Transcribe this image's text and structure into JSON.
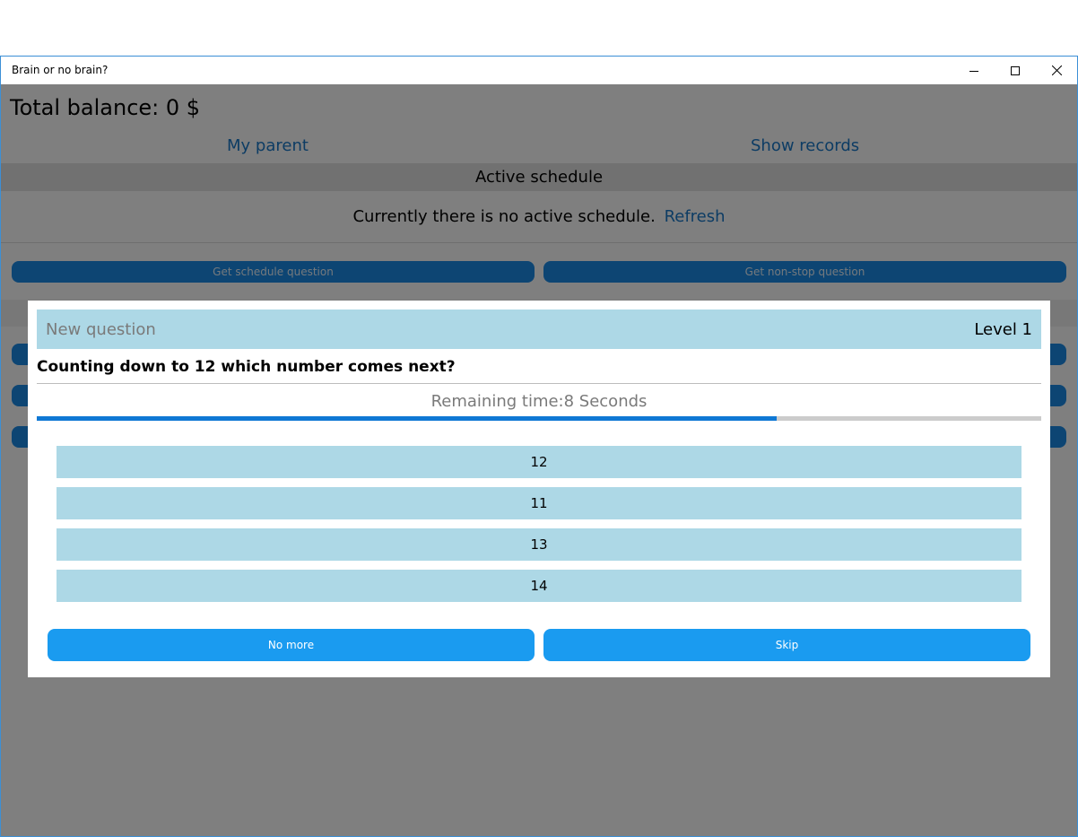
{
  "window": {
    "title": "Brain or no brain?",
    "controls": {
      "minimize": "minimize-icon",
      "maximize": "maximize-icon",
      "close": "close-icon"
    }
  },
  "main": {
    "balance": "Total balance: 0 $",
    "nav": {
      "parent": "My parent",
      "records": "Show records"
    },
    "schedule_header": "Active schedule",
    "schedule_status": "Currently there is no active schedule.",
    "refresh": "Refresh",
    "buttons": {
      "schedule_question": "Get schedule question",
      "nonstop_question": "Get non-stop question"
    }
  },
  "dialog": {
    "title": "New question",
    "level": "Level 1",
    "question": "Counting down to 12 which number comes next?",
    "remaining": "Remaining time:8 Seconds",
    "progress_fraction": 0.737,
    "answers": [
      "12",
      "11",
      "13",
      "14"
    ],
    "no_more": "No more",
    "skip": "Skip"
  },
  "colors": {
    "accent": "#1a79c8",
    "button": "#1a8ae6",
    "dialog_button": "#1a9bf0",
    "answer_bg": "#add8e6",
    "progress": "#0f78d4"
  }
}
